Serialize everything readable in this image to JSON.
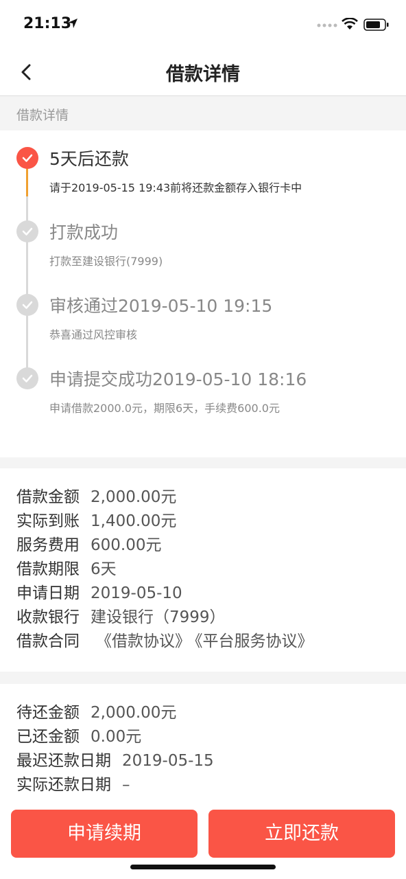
{
  "status": {
    "time": "21:13"
  },
  "nav": {
    "title": "借款详情"
  },
  "section": {
    "header": "借款详情"
  },
  "timeline": [
    {
      "title": "5天后还款",
      "subtitle": "请于2019-05-15 19:43前将还款金额存入银行卡中",
      "active": true
    },
    {
      "title": "打款成功",
      "subtitle": "打款至建设银行(7999)",
      "active": false
    },
    {
      "title": "审核通过2019-05-10 19:15",
      "subtitle": "恭喜通过风控审核",
      "active": false
    },
    {
      "title": "申请提交成功2019-05-10 18:16",
      "subtitle": "申请借款2000.0元，期限6天，手续费600.0元",
      "active": false
    }
  ],
  "loan_info": {
    "amount_label": "借款金额",
    "amount_value": "2,000.00元",
    "received_label": "实际到账",
    "received_value": "1,400.00元",
    "fee_label": "服务费用",
    "fee_value": "600.00元",
    "term_label": "借款期限",
    "term_value": "6天",
    "date_label": "申请日期",
    "date_value": "2019-05-10",
    "bank_label": "收款银行",
    "bank_value": "建设银行（7999）",
    "contract_label": "借款合同",
    "contract_link1": "《借款协议》",
    "contract_link2": "《平台服务协议》"
  },
  "repay_info": {
    "due_label": "待还金额",
    "due_value": "2,000.00元",
    "paid_label": "已还金额",
    "paid_value": "0.00元",
    "deadline_label": "最迟还款日期",
    "deadline_value": "2019-05-15",
    "actual_label": "实际还款日期",
    "actual_value": "–"
  },
  "buttons": {
    "extend": "申请续期",
    "repay": "立即还款"
  },
  "colors": {
    "accent": "#fa5546",
    "timeline_active_line": "#f0a030",
    "inactive": "#d9d9d9"
  }
}
